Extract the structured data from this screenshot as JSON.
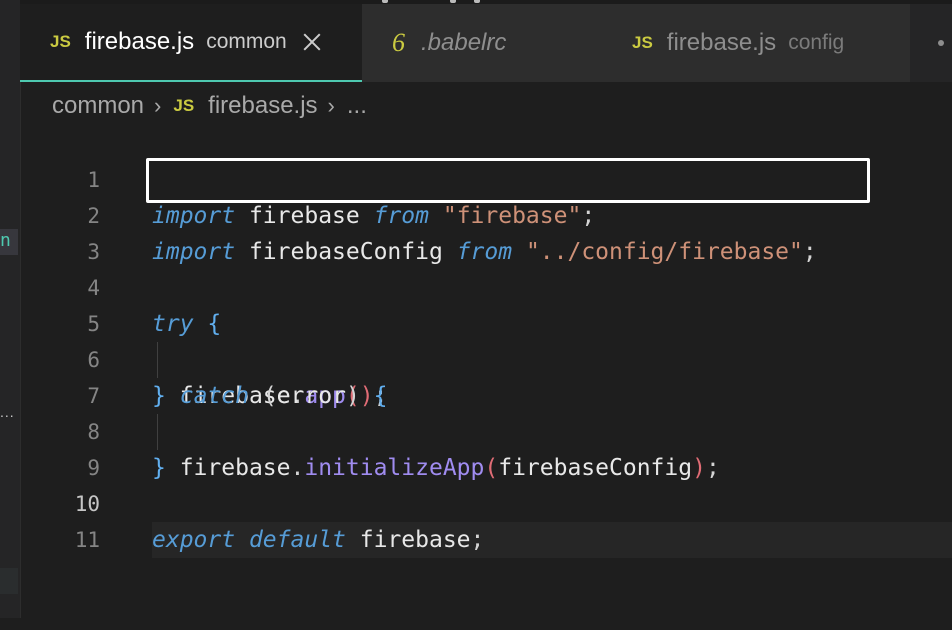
{
  "tabs": [
    {
      "icon": "JS",
      "label": "firebase.js",
      "description": "common",
      "active": true
    },
    {
      "icon": "6",
      "label": ".babelrc",
      "description": "",
      "active": false
    },
    {
      "icon": "JS",
      "label": "firebase.js",
      "description": "config",
      "active": false
    }
  ],
  "breadcrumb": {
    "folder": "common",
    "file_icon": "JS",
    "file": "firebase.js",
    "more": "..."
  },
  "sidebar_fragment": {
    "text": "n",
    "dots": "..."
  },
  "icons": {
    "tab_close": "close-icon",
    "breadcrumb_separator": "chevron-right-icon",
    "tab_overflow": "more-icon"
  },
  "editor": {
    "language": "javascript",
    "current_line": 10,
    "highlighted_line": 2,
    "lines": [
      {
        "number": "1",
        "text": "import firebase from \"firebase\";"
      },
      {
        "number": "2",
        "text": "import firebaseConfig from \"../config/firebase\";"
      },
      {
        "number": "3",
        "text": ""
      },
      {
        "number": "4",
        "text": "try {"
      },
      {
        "number": "5",
        "text": "  firebase.app();"
      },
      {
        "number": "6",
        "text": "} catch (error) {"
      },
      {
        "number": "7",
        "text": "  firebase.initializeApp(firebaseConfig);"
      },
      {
        "number": "8",
        "text": "}"
      },
      {
        "number": "9",
        "text": ""
      },
      {
        "number": "10",
        "text": "export default firebase;"
      },
      {
        "number": "11",
        "text": ""
      }
    ],
    "tokens": {
      "l1": {
        "import": "import",
        "firebase": "firebase",
        "from": "from",
        "str": "\"firebase\"",
        "semi": ";"
      },
      "l2": {
        "import": "import",
        "firebaseConfig": "firebaseConfig",
        "from": "from",
        "str": "\"../config/firebase\"",
        "semi": ";"
      },
      "l4": {
        "try": "try",
        "brace": "{"
      },
      "l5": {
        "obj": "firebase",
        "dot": ".",
        "method": "app",
        "open": "(",
        "close": ")",
        "semi": ";"
      },
      "l6": {
        "brace_close": "}",
        "catch": "catch",
        "paren_open": "(",
        "param": "error",
        "paren_close": ")",
        "brace": "{"
      },
      "l7": {
        "obj": "firebase",
        "dot": ".",
        "method": "initializeApp",
        "open": "(",
        "arg": "firebaseConfig",
        "close": ")",
        "semi": ";"
      },
      "l8": {
        "brace": "}"
      },
      "l10": {
        "export": "export",
        "default": "default",
        "id": "firebase",
        "semi": ";"
      }
    }
  },
  "colors": {
    "background": "#1e1e1e",
    "tab_active_border": "#4ec9b0",
    "js_icon": "#cbcb41",
    "keyword": "#569cd6",
    "string": "#ce9178",
    "function": "#a08cf0",
    "highlight_box": "#ffffff"
  }
}
